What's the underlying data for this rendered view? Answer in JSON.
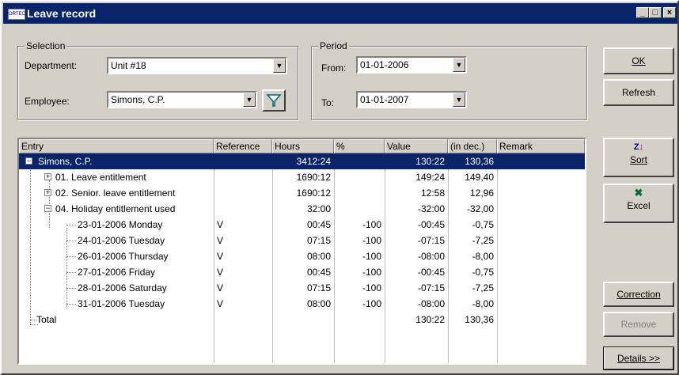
{
  "window": {
    "title": "Leave record",
    "app_icon": "app-icon",
    "minimize": "_",
    "maximize": "□",
    "close": "×"
  },
  "selection": {
    "group_label": "Selection",
    "department_label": "Department:",
    "department_value": "Unit #18",
    "employee_label": "Employee:",
    "employee_value": "Simons, C.P."
  },
  "period": {
    "group_label": "Period",
    "from_label": "From:",
    "from_value": "01-01-2006",
    "to_label": "To:",
    "to_value": "01-01-2007"
  },
  "buttons": {
    "ok": "OK",
    "refresh": "Refresh",
    "sort": "Sort",
    "excel": "Excel",
    "correction": "Correction",
    "remove": "Remove",
    "details": "Details >>"
  },
  "table": {
    "columns": [
      "Entry",
      "Reference",
      "Hours",
      "%",
      "Value",
      "(in dec.)",
      "Remark"
    ],
    "rows": [
      {
        "entry": "Simons, C.P.",
        "ref": "",
        "hours": "3412:24",
        "pct": "",
        "value": "130:22",
        "dec": "130,36",
        "remark": ""
      },
      {
        "entry": "01. Leave entitlement",
        "ref": "",
        "hours": "1690:12",
        "pct": "",
        "value": "149:24",
        "dec": "149,40",
        "remark": ""
      },
      {
        "entry": "02. Senior. leave entitlement",
        "ref": "",
        "hours": "1690:12",
        "pct": "",
        "value": "12:58",
        "dec": "12,96",
        "remark": ""
      },
      {
        "entry": "04. Holiday entitlement used",
        "ref": "",
        "hours": "32:00",
        "pct": "",
        "value": "-32:00",
        "dec": "-32,00",
        "remark": ""
      },
      {
        "entry": "23-01-2006 Monday",
        "ref": "V",
        "hours": "00:45",
        "pct": "-100",
        "value": "-00:45",
        "dec": "-0,75",
        "remark": ""
      },
      {
        "entry": "24-01-2006 Tuesday",
        "ref": "V",
        "hours": "07:15",
        "pct": "-100",
        "value": "-07:15",
        "dec": "-7,25",
        "remark": ""
      },
      {
        "entry": "26-01-2006 Thursday",
        "ref": "V",
        "hours": "08:00",
        "pct": "-100",
        "value": "-08:00",
        "dec": "-8,00",
        "remark": ""
      },
      {
        "entry": "27-01-2006 Friday",
        "ref": "V",
        "hours": "00:45",
        "pct": "-100",
        "value": "-00:45",
        "dec": "-0,75",
        "remark": ""
      },
      {
        "entry": "28-01-2006 Saturday",
        "ref": "V",
        "hours": "07:15",
        "pct": "-100",
        "value": "-07:15",
        "dec": "-7,25",
        "remark": ""
      },
      {
        "entry": "31-01-2006 Tuesday",
        "ref": "V",
        "hours": "08:00",
        "pct": "-100",
        "value": "-08:00",
        "dec": "-8,00",
        "remark": ""
      },
      {
        "entry": "Total",
        "ref": "",
        "hours": "",
        "pct": "",
        "value": "130:22",
        "dec": "130,36",
        "remark": ""
      }
    ]
  },
  "colors": {
    "selection": "#0a246a",
    "face": "#d4d0c8"
  }
}
